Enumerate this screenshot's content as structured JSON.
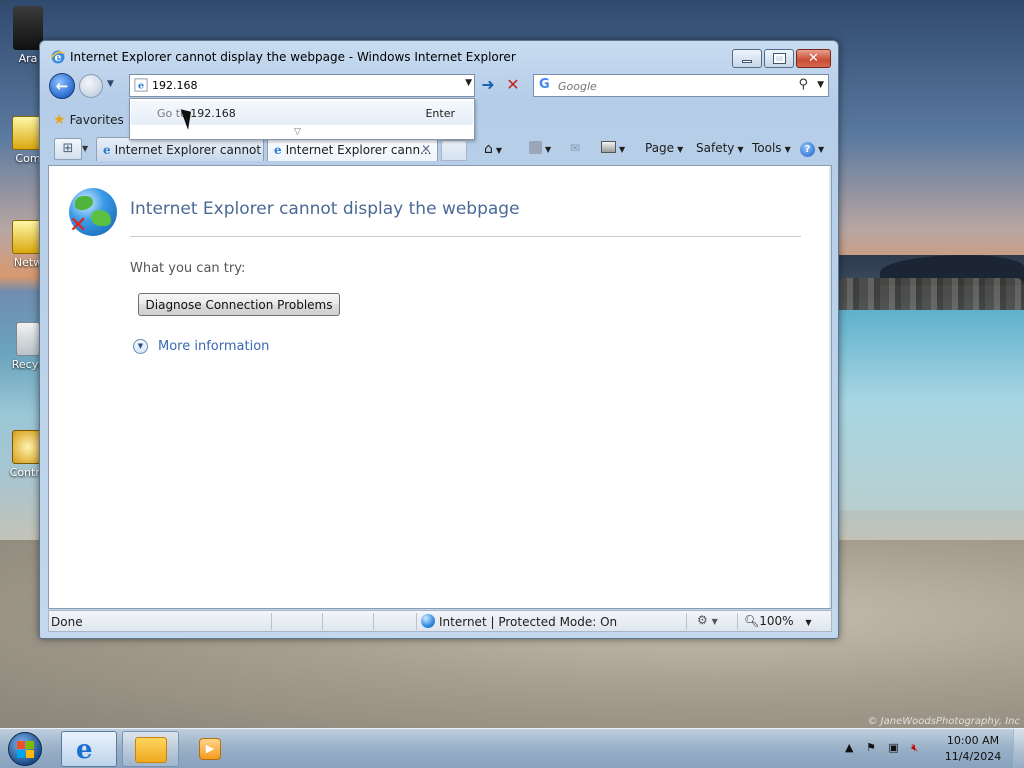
{
  "desktop": {
    "icons": [
      {
        "label": "Ara"
      },
      {
        "label": "Com"
      },
      {
        "label": "Netw"
      },
      {
        "label": "Recyc"
      },
      {
        "label": "Contro"
      }
    ],
    "watermark": "© JaneWoodsPhotography, Inc"
  },
  "window": {
    "title": "Internet Explorer cannot display the webpage - Windows Internet Explorer"
  },
  "address_bar": {
    "value": "192.168"
  },
  "autocomplete": {
    "goto_prefix": "Go to",
    "goto_value": "192.168",
    "enter_label": "Enter"
  },
  "search": {
    "placeholder": "Google"
  },
  "favorites": {
    "label": "Favorites"
  },
  "tabs": [
    {
      "label": "Internet Explorer cannot ..."
    },
    {
      "label": "Internet Explorer cann..."
    }
  ],
  "command_bar": {
    "page": "Page",
    "safety": "Safety",
    "tools": "Tools"
  },
  "content": {
    "title": "Internet Explorer cannot display the webpage",
    "try_label": "What you can try:",
    "diagnose_button": "Diagnose Connection Problems",
    "more_info": "More information"
  },
  "status_bar": {
    "status": "Done",
    "zone": "Internet | Protected Mode: On",
    "zoom": "100%"
  },
  "taskbar": {
    "time": "10:00 AM",
    "date": "11/4/2024"
  },
  "colors": {
    "title_link": "#4a6a96",
    "link": "#3a6ab0",
    "close_button": "#c84c33"
  }
}
